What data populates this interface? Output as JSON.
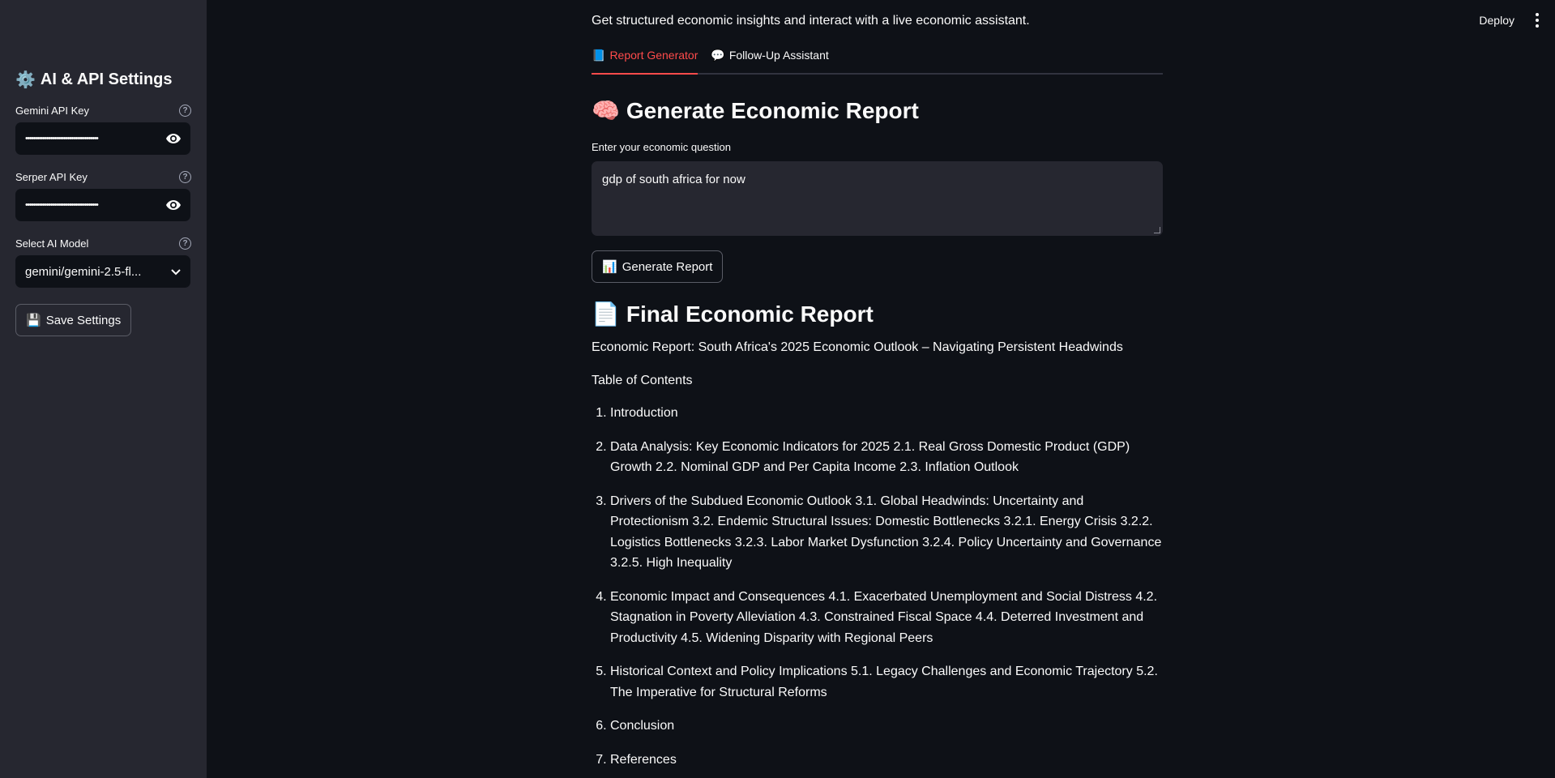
{
  "sidebar": {
    "title_emoji": "⚙️",
    "title": "AI & API Settings",
    "gemini": {
      "label": "Gemini API Key",
      "value": "••••••••••••••••••••••••••••••••••••••"
    },
    "serper": {
      "label": "Serper API Key",
      "value": "••••••••••••••••••••••••••••••••••••••"
    },
    "model": {
      "label": "Select AI Model",
      "value": "gemini/gemini-2.5-fl..."
    },
    "save_emoji": "💾",
    "save_label": "Save Settings"
  },
  "topbar": {
    "deploy_label": "Deploy"
  },
  "main": {
    "subtitle": "Get structured economic insights and interact with a live economic assistant.",
    "tabs": [
      {
        "emoji": "📘",
        "label": "Report Generator",
        "active": true
      },
      {
        "emoji": "💬",
        "label": "Follow-Up Assistant",
        "active": false
      }
    ],
    "generate_heading_emoji": "🧠",
    "generate_heading": "Generate Economic Report",
    "question_label": "Enter your economic question",
    "question_value": "gdp of south africa for now",
    "generate_emoji": "📊",
    "generate_button": "Generate Report",
    "final_heading_emoji": "📄",
    "final_heading": "Final Economic Report",
    "report_title": "Economic Report: South Africa's 2025 Economic Outlook – Navigating Persistent Headwinds",
    "toc_heading": "Table of Contents",
    "toc": [
      "Introduction",
      "Data Analysis: Key Economic Indicators for 2025 2.1. Real Gross Domestic Product (GDP) Growth 2.2. Nominal GDP and Per Capita Income 2.3. Inflation Outlook",
      "Drivers of the Subdued Economic Outlook 3.1. Global Headwinds: Uncertainty and Protectionism 3.2. Endemic Structural Issues: Domestic Bottlenecks 3.2.1. Energy Crisis 3.2.2. Logistics Bottlenecks 3.2.3. Labor Market Dysfunction 3.2.4. Policy Uncertainty and Governance 3.2.5. High Inequality",
      "Economic Impact and Consequences 4.1. Exacerbated Unemployment and Social Distress 4.2. Stagnation in Poverty Alleviation 4.3. Constrained Fiscal Space 4.4. Deterred Investment and Productivity 4.5. Widening Disparity with Regional Peers",
      "Historical Context and Policy Implications 5.1. Legacy Challenges and Economic Trajectory 5.2. The Imperative for Structural Reforms",
      "Conclusion",
      "References"
    ]
  }
}
